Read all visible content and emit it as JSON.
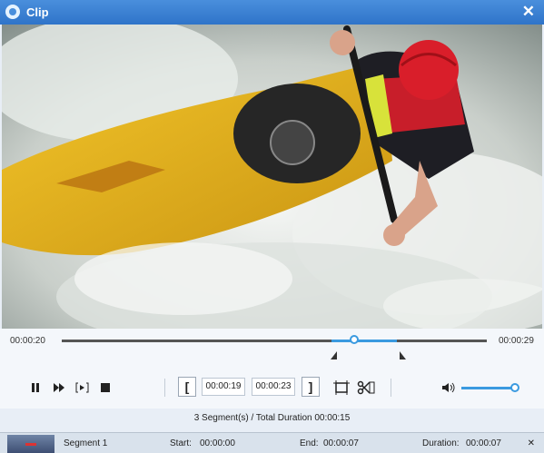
{
  "window": {
    "title": "Clip",
    "close_label": "✕"
  },
  "timeline": {
    "current_time": "00:00:20",
    "end_time": "00:00:29"
  },
  "controls": {
    "start_bracket": "[",
    "end_bracket": "]",
    "start_time": "00:00:19",
    "end_time": "00:00:23",
    "volume_level": 0.85
  },
  "summary": {
    "text": "3 Segment(s) / Total Duration 00:00:15"
  },
  "segments": [
    {
      "name": "Segment 1",
      "start_label": "Start:",
      "start": "00:00:00",
      "end_label": "End:",
      "end": "00:00:07",
      "duration_label": "Duration:",
      "duration": "00:00:07"
    }
  ],
  "icons": {
    "app": "app-logo-icon",
    "pause": "pause-icon",
    "fast_forward": "fast-forward-icon",
    "next_frame": "next-frame-icon",
    "stop": "stop-icon",
    "crop": "crop-icon",
    "scissors": "scissors-icon",
    "volume": "volume-icon"
  },
  "colors": {
    "title_bar": "#3a82d6",
    "accent": "#3a9ae0",
    "kayak": "#e9b91b",
    "helmet": "#d91e2a"
  }
}
